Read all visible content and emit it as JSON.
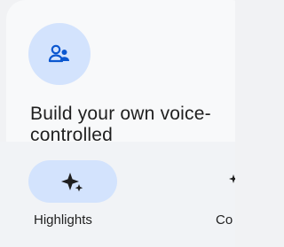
{
  "card": {
    "icon": "person-group-icon",
    "text": "Build your own voice-controlled"
  },
  "bottom_nav": {
    "items": [
      {
        "label": "Highlights",
        "icon": "sparkle-icon",
        "selected": true
      },
      {
        "label": "Co",
        "icon": "sparkle-icon",
        "selected": false
      }
    ]
  },
  "colors": {
    "accent_container": "#d3e3fd",
    "accent_icon": "#0b57d0",
    "text": "#1f1f1f"
  }
}
